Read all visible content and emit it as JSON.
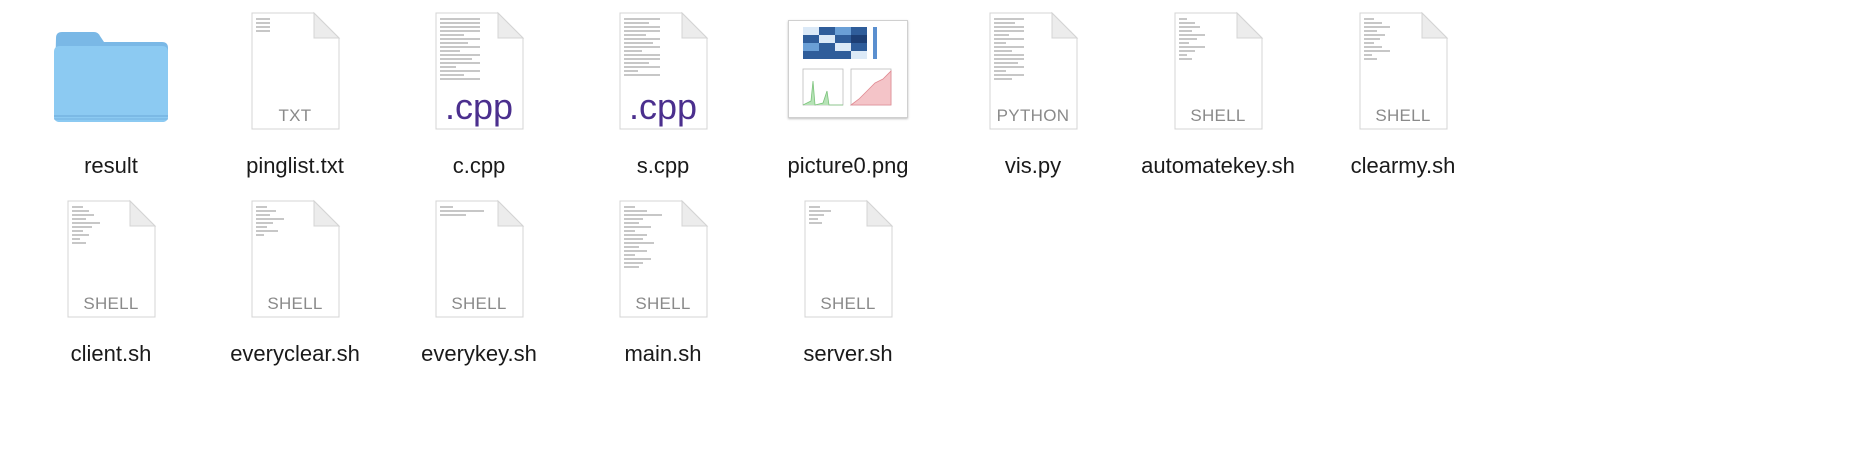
{
  "files": [
    {
      "name": "result",
      "type": "folder"
    },
    {
      "name": "pinglist.txt",
      "type": "doc",
      "ext": "TXT"
    },
    {
      "name": "c.cpp",
      "type": "doc",
      "ext": ".cpp"
    },
    {
      "name": "s.cpp",
      "type": "doc",
      "ext": ".cpp"
    },
    {
      "name": "picture0.png",
      "type": "picture"
    },
    {
      "name": "vis.py",
      "type": "doc",
      "ext": "PYTHON"
    },
    {
      "name": "automatekey.sh",
      "type": "doc",
      "ext": "SHELL"
    },
    {
      "name": "clearmy.sh",
      "type": "doc",
      "ext": "SHELL"
    },
    {
      "name": "client.sh",
      "type": "doc",
      "ext": "SHELL"
    },
    {
      "name": "everyclear.sh",
      "type": "doc",
      "ext": "SHELL"
    },
    {
      "name": "everykey.sh",
      "type": "doc",
      "ext": "SHELL"
    },
    {
      "name": "main.sh",
      "type": "doc",
      "ext": "SHELL"
    },
    {
      "name": "server.sh",
      "type": "doc",
      "ext": "SHELL"
    }
  ],
  "colors": {
    "folder": "#8ccaf2",
    "cpp_label": "#4b2f8e",
    "doc_label": "#8a8a8a"
  }
}
